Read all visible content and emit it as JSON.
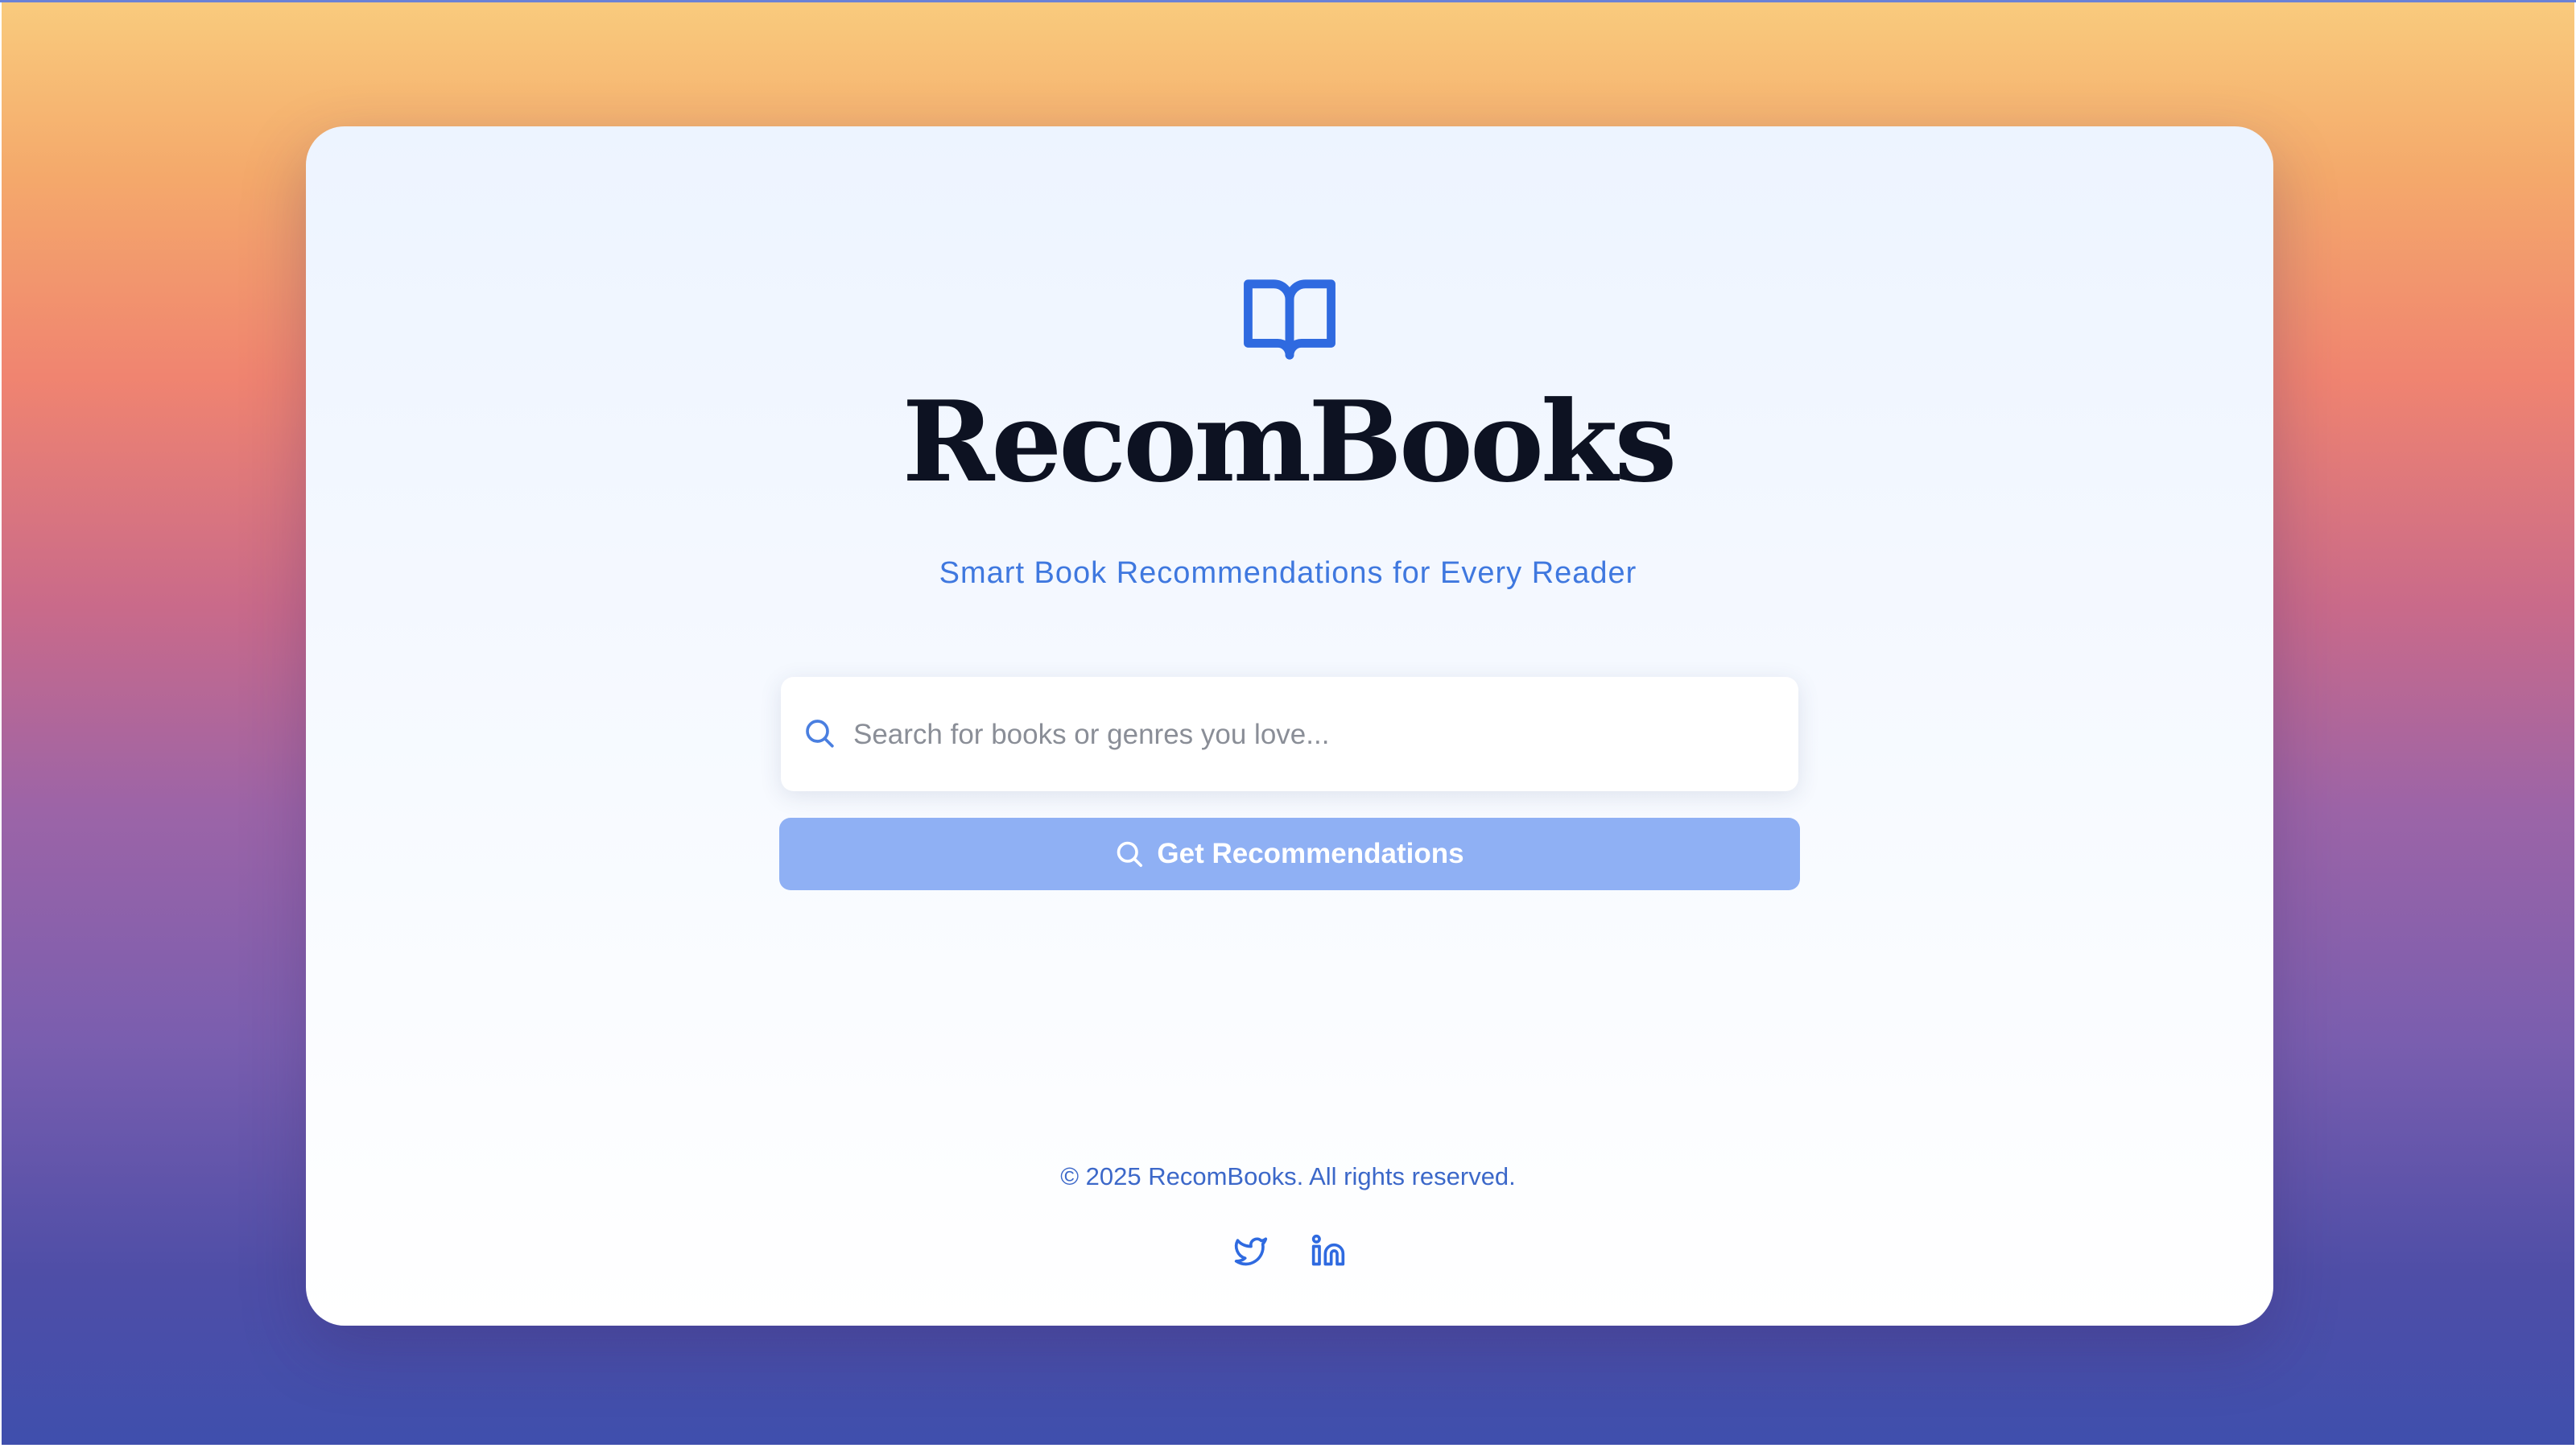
{
  "app": {
    "title": "RecomBooks",
    "subtitle": "Smart Book Recommendations for Every Reader",
    "logo_icon": "open-book-icon"
  },
  "search": {
    "placeholder": "Search for books or genres you love...",
    "value": "",
    "icon": "search-icon"
  },
  "cta": {
    "label": "Get Recommendations",
    "icon": "search-icon"
  },
  "footer": {
    "copyright": "© 2025 RecomBooks. All rights reserved.",
    "social": [
      {
        "icon": "twitter-icon"
      },
      {
        "icon": "linkedin-icon"
      }
    ]
  },
  "colors": {
    "accent": "#2f6ae0",
    "button_bg": "#8fb0f4",
    "title_text": "#0d1222",
    "subtitle_text": "#3f78df",
    "background_top": "#f9cb7d",
    "background_mid": "#f08470",
    "background_bottom": "#3f4fad"
  }
}
